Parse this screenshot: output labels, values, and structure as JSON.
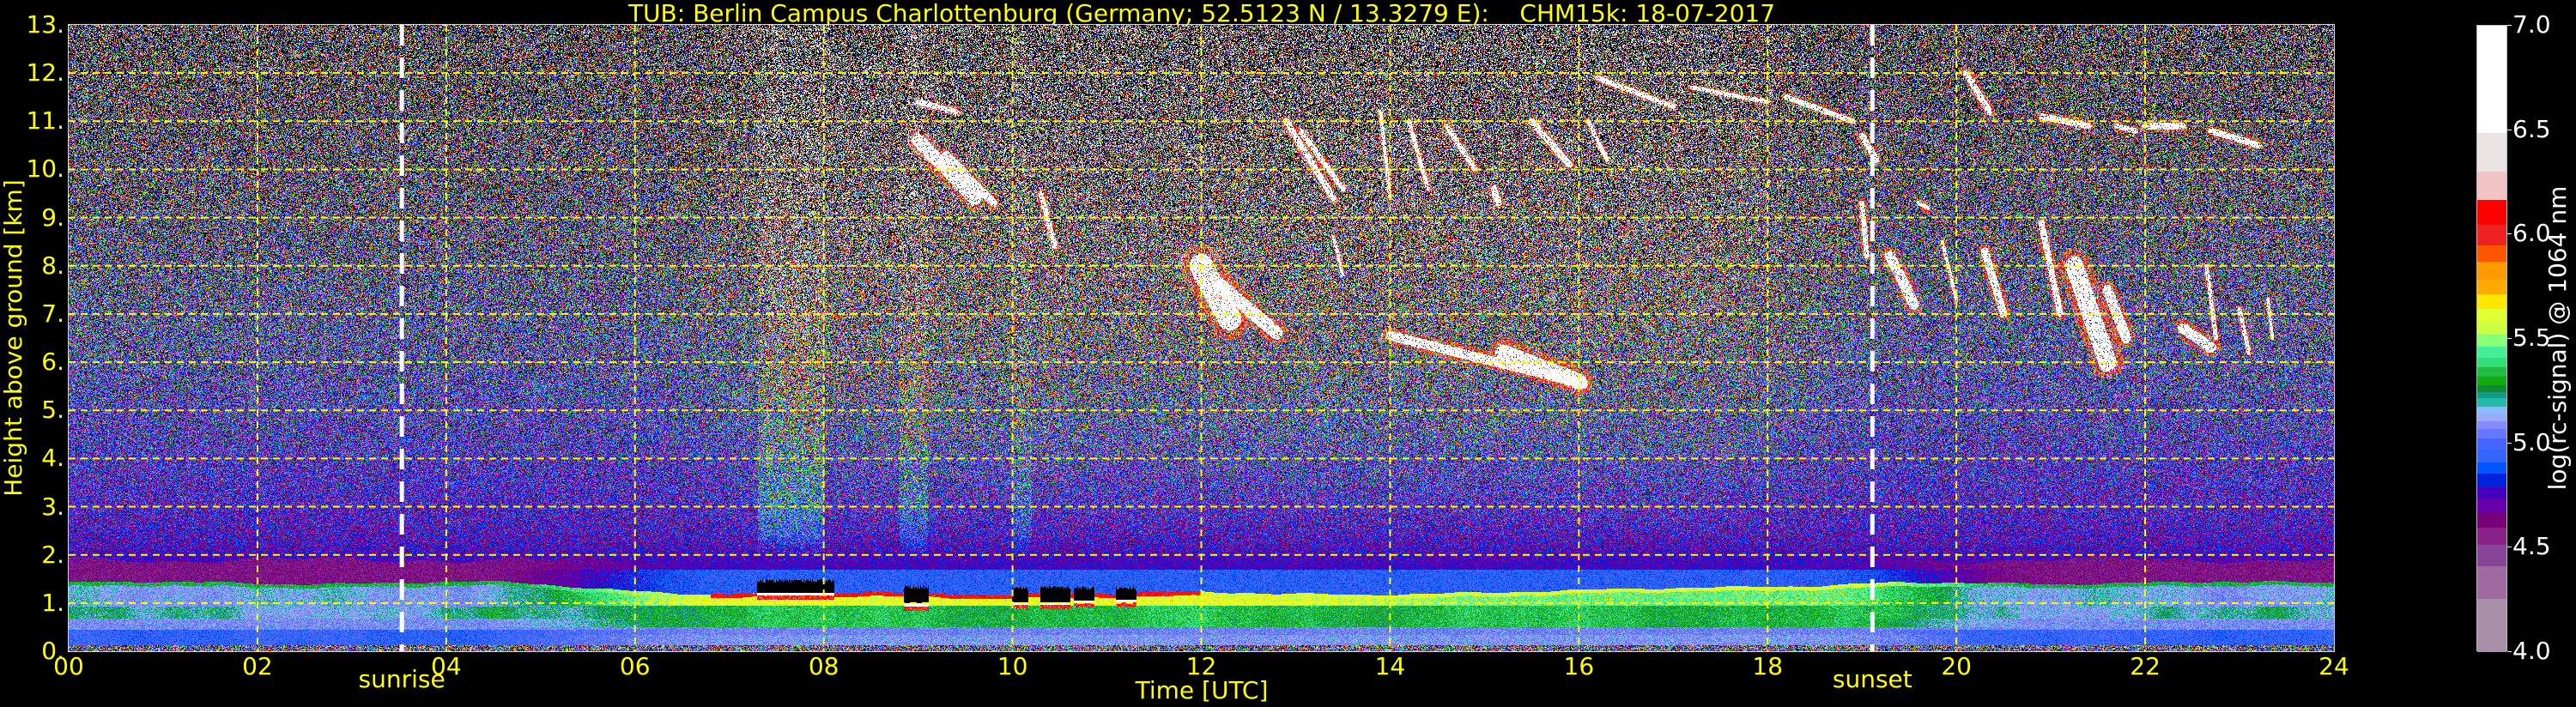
{
  "chart_data": {
    "type": "heatmap",
    "title": "TUB: Berlin Campus Charlottenburg (Germany; 52.5123 N / 13.3279 E):    CHM15k: 18-07-2017",
    "xlabel": "Time [UTC]",
    "ylabel": "Height above ground [km]",
    "xlim": [
      0,
      24
    ],
    "ylim": [
      0,
      13
    ],
    "grid": true,
    "xticks": [
      0,
      2,
      4,
      6,
      8,
      10,
      12,
      14,
      16,
      18,
      20,
      22,
      24
    ],
    "xtick_labels": [
      "00",
      "02",
      "04",
      "06",
      "08",
      "10",
      "12",
      "14",
      "16",
      "18",
      "20",
      "22",
      "24"
    ],
    "yticks": [
      0,
      1,
      2,
      3,
      4,
      5,
      6,
      7,
      8,
      9,
      10,
      11,
      12,
      13
    ],
    "ytick_labels": [
      "0.",
      "1.",
      "2.",
      "3.",
      "4.",
      "5.",
      "6.",
      "7.",
      "8.",
      "9.",
      "10.",
      "11.",
      "12.",
      "13."
    ],
    "annotations": [
      {
        "label": "sunrise",
        "time": 3.53
      },
      {
        "label": "sunset",
        "time": 19.11
      }
    ],
    "colorbar": {
      "label": "log(rc-signal) @ 1064 nm",
      "range": [
        4.0,
        7.0
      ],
      "ticks": [
        4.0,
        4.5,
        5.0,
        5.5,
        6.0,
        6.5,
        7.0
      ],
      "tick_labels": [
        "4.0",
        "4.5",
        "5.0",
        "5.5",
        "6.0",
        "6.5",
        "7.0"
      ],
      "levels_desc": [
        7.0,
        6.485,
        6.3,
        6.165,
        6.045,
        5.95,
        5.87,
        5.785,
        5.715,
        5.645,
        5.58,
        5.52,
        5.465,
        5.41,
        5.365,
        5.32,
        5.28,
        5.245,
        5.215,
        5.175,
        5.14,
        5.105,
        5.07,
        5.025,
        4.97,
        4.91,
        4.855,
        4.79,
        4.735,
        4.67,
        4.595,
        4.515,
        4.41,
        4.255,
        4.0
      ],
      "colors_desc": [
        "#ffffff",
        "#ebe3e3",
        "#f0c4c4",
        "#ff0000",
        "#ee2222",
        "#ff5500",
        "#ff9900",
        "#ffaa00",
        "#ffe600",
        "#ddff33",
        "#ccff44",
        "#88ff77",
        "#44ee99",
        "#33dd77",
        "#22bb44",
        "#11aa11",
        "#118833",
        "#119988",
        "#22bbaa",
        "#88bbff",
        "#99aaff",
        "#8888ff",
        "#6677ff",
        "#4466ff",
        "#3366ff",
        "#0055ff",
        "#0022dd",
        "#4400bb",
        "#6600aa",
        "#770077",
        "#882288",
        "#884499",
        "#a06aa0",
        "#a890a8"
      ]
    },
    "features": {
      "boundary_layer_top_km": {
        "night": 1.42,
        "day": 1.2
      },
      "cirrus_streaks": [
        {
          "t": [
            9.0,
            9.6
          ],
          "h": [
            10.6,
            9.4
          ],
          "w": 0.25
        },
        {
          "t": [
            9.3,
            9.8
          ],
          "h": [
            10.3,
            9.3
          ],
          "w": 0.15
        },
        {
          "t": [
            9.0,
            9.4
          ],
          "h": [
            11.4,
            11.2
          ],
          "w": 0.1
        },
        {
          "t": [
            10.3,
            10.45
          ],
          "h": [
            9.5,
            8.4
          ],
          "w": 0.1
        },
        {
          "t": [
            12.0,
            12.3
          ],
          "h": [
            8.0,
            6.9
          ],
          "w": 0.45
        },
        {
          "t": [
            12.2,
            12.8
          ],
          "h": [
            7.6,
            6.6
          ],
          "w": 0.25
        },
        {
          "t": [
            12.9,
            13.4
          ],
          "h": [
            11.0,
            9.4
          ],
          "w": 0.12
        },
        {
          "t": [
            13.05,
            13.5
          ],
          "h": [
            10.8,
            9.6
          ],
          "w": 0.1
        },
        {
          "t": [
            13.4,
            13.5
          ],
          "h": [
            8.6,
            7.8
          ],
          "w": 0.06
        },
        {
          "t": [
            13.9,
            14.0
          ],
          "h": [
            11.2,
            9.4
          ],
          "w": 0.07
        },
        {
          "t": [
            14.2,
            14.4
          ],
          "h": [
            11.0,
            9.6
          ],
          "w": 0.08
        },
        {
          "t": [
            14.0,
            16.05
          ],
          "h": [
            6.55,
            5.55
          ],
          "w": 0.18
        },
        {
          "t": [
            15.2,
            16.0
          ],
          "h": [
            6.2,
            5.6
          ],
          "w": 0.3
        },
        {
          "t": [
            14.6,
            14.9
          ],
          "h": [
            10.9,
            10.0
          ],
          "w": 0.1
        },
        {
          "t": [
            15.1,
            15.15
          ],
          "h": [
            9.6,
            9.3
          ],
          "w": 0.12
        },
        {
          "t": [
            15.5,
            15.9
          ],
          "h": [
            11.0,
            10.1
          ],
          "w": 0.12
        },
        {
          "t": [
            16.1,
            16.3
          ],
          "h": [
            11.0,
            10.2
          ],
          "w": 0.08
        },
        {
          "t": [
            16.2,
            17.0
          ],
          "h": [
            11.9,
            11.3
          ],
          "w": 0.1
        },
        {
          "t": [
            17.2,
            18.0
          ],
          "h": [
            11.7,
            11.4
          ],
          "w": 0.08
        },
        {
          "t": [
            18.2,
            18.9
          ],
          "h": [
            11.5,
            11.0
          ],
          "w": 0.1
        },
        {
          "t": [
            19.0,
            19.15
          ],
          "h": [
            10.7,
            10.2
          ],
          "w": 0.12
        },
        {
          "t": [
            19.0,
            19.05
          ],
          "h": [
            9.3,
            8.2
          ],
          "w": 0.1
        },
        {
          "t": [
            19.3,
            19.55
          ],
          "h": [
            8.2,
            7.2
          ],
          "w": 0.2
        },
        {
          "t": [
            19.6,
            19.7
          ],
          "h": [
            9.3,
            9.2
          ],
          "w": 0.08
        },
        {
          "t": [
            19.85,
            20.0
          ],
          "h": [
            8.5,
            7.3
          ],
          "w": 0.07
        },
        {
          "t": [
            20.3,
            20.5
          ],
          "h": [
            8.3,
            7.0
          ],
          "w": 0.15
        },
        {
          "t": [
            20.9,
            21.1
          ],
          "h": [
            8.9,
            7.0
          ],
          "w": 0.12
        },
        {
          "t": [
            21.25,
            21.6
          ],
          "h": [
            8.0,
            6.0
          ],
          "w": 0.35
        },
        {
          "t": [
            21.6,
            21.8
          ],
          "h": [
            7.5,
            6.5
          ],
          "w": 0.2
        },
        {
          "t": [
            22.4,
            22.7
          ],
          "h": [
            6.7,
            6.3
          ],
          "w": 0.2
        },
        {
          "t": [
            22.65,
            22.75
          ],
          "h": [
            8.0,
            6.5
          ],
          "w": 0.08
        },
        {
          "t": [
            23.0,
            23.1
          ],
          "h": [
            7.1,
            6.2
          ],
          "w": 0.08
        },
        {
          "t": [
            23.3,
            23.35
          ],
          "h": [
            7.3,
            6.5
          ],
          "w": 0.06
        },
        {
          "t": [
            20.1,
            20.35
          ],
          "h": [
            12.0,
            11.2
          ],
          "w": 0.12
        },
        {
          "t": [
            20.9,
            21.4
          ],
          "h": [
            11.1,
            10.9
          ],
          "w": 0.12
        },
        {
          "t": [
            21.7,
            21.9
          ],
          "h": [
            10.9,
            10.8
          ],
          "w": 0.1
        },
        {
          "t": [
            22.0,
            22.4
          ],
          "h": [
            10.9,
            10.9
          ],
          "w": 0.12
        },
        {
          "t": [
            22.7,
            23.2
          ],
          "h": [
            10.8,
            10.5
          ],
          "w": 0.12
        }
      ],
      "no_signal_above_low_cloud": [
        {
          "t": [
            7.3,
            8.1
          ],
          "h": [
            1.24,
            1.45
          ]
        },
        {
          "t": [
            8.85,
            9.1
          ],
          "h": [
            1.02,
            1.32
          ]
        },
        {
          "t": [
            10.0,
            10.15
          ],
          "h": [
            1.05,
            1.3
          ]
        },
        {
          "t": [
            10.3,
            10.6
          ],
          "h": [
            1.05,
            1.32
          ]
        },
        {
          "t": [
            10.65,
            10.85
          ],
          "h": [
            1.08,
            1.3
          ]
        },
        {
          "t": [
            11.1,
            11.3
          ],
          "h": [
            1.1,
            1.3
          ]
        }
      ],
      "precip_columns": [
        {
          "t": [
            7.3,
            8.0
          ],
          "boost": 0.35
        },
        {
          "t": [
            8.8,
            9.1
          ],
          "boost": 0.3
        },
        {
          "t": [
            10.0,
            10.2
          ],
          "boost": 0.25
        }
      ]
    },
    "colors": {
      "text": "#ffff00",
      "grid": "#ffff00",
      "sun_lines": "#ffffff",
      "background": "#000000"
    }
  }
}
